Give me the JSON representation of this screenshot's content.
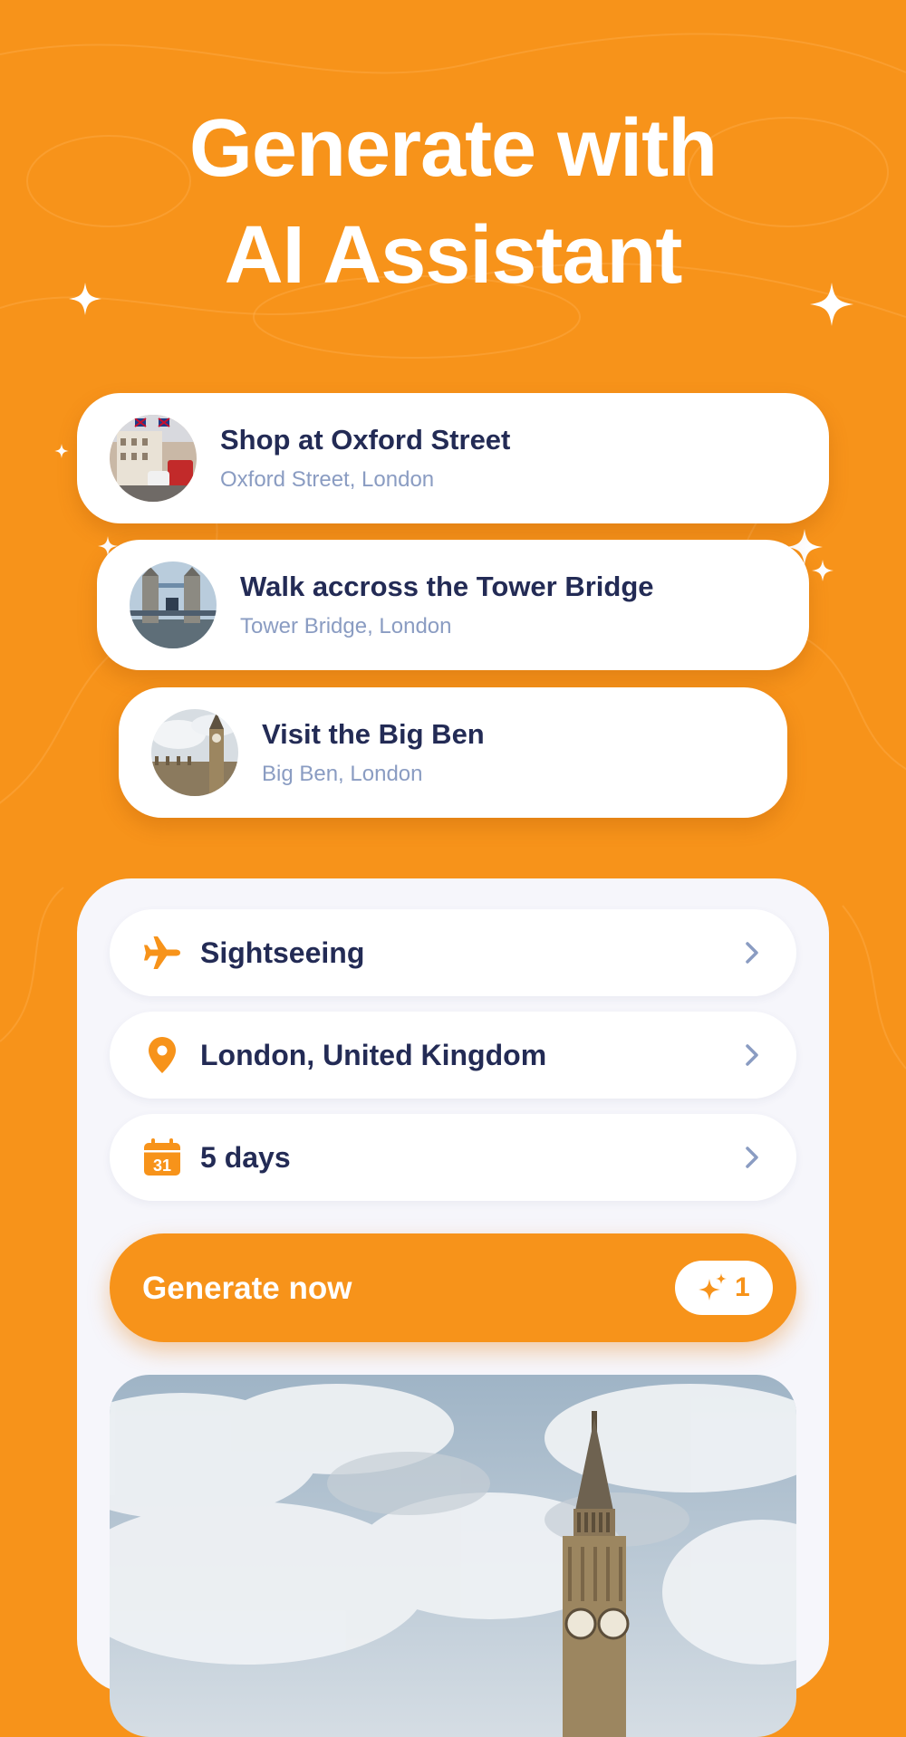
{
  "headline": {
    "line1": "Generate with",
    "line2": "AI Assistant"
  },
  "suggestions": [
    {
      "title": "Shop at Oxford Street",
      "subtitle": "Oxford Street, London",
      "image": "oxford-street-photo"
    },
    {
      "title": "Walk accross the Tower Bridge",
      "subtitle": "Tower Bridge, London",
      "image": "tower-bridge-photo"
    },
    {
      "title": "Visit the Big Ben",
      "subtitle": "Big Ben, London",
      "image": "big-ben-photo"
    }
  ],
  "options": [
    {
      "icon": "airplane-icon",
      "label": "Sightseeing"
    },
    {
      "icon": "location-pin-icon",
      "label": "London, United Kingdom"
    },
    {
      "icon": "calendar-icon",
      "label": "5 days",
      "icon_text": "31"
    }
  ],
  "generate": {
    "label": "Generate now",
    "credit_icon": "sparkles-icon",
    "credits": "1"
  },
  "colors": {
    "accent": "#F7931A",
    "navy": "#232B55",
    "muted": "#8A9CC2",
    "panel": "#F6F6FB"
  }
}
